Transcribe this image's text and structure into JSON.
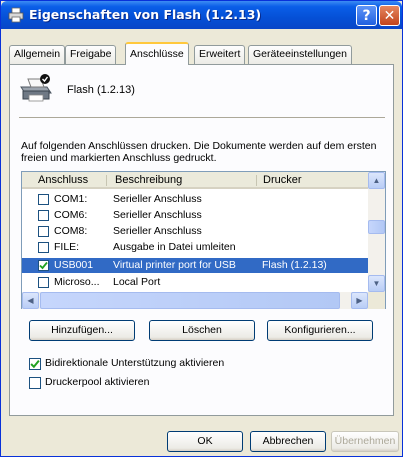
{
  "window": {
    "title": "Eigenschaften von Flash (1.2.13)",
    "help_label": "?",
    "close_label": "✕"
  },
  "tabs": [
    {
      "label": "Allgemein",
      "active": false
    },
    {
      "label": "Freigabe",
      "active": false
    },
    {
      "label": "Anschlüsse",
      "active": true
    },
    {
      "label": "Erweitert",
      "active": false
    },
    {
      "label": "Geräteeinstellungen",
      "active": false
    }
  ],
  "printer": {
    "name": "Flash (1.2.13)",
    "icon": "printer-icon"
  },
  "description": "Auf folgenden Anschlüssen drucken. Die Dokumente werden auf dem ersten freien und markierten Anschluss gedruckt.",
  "ports": {
    "headers": [
      "Anschluss",
      "Beschreibung",
      "Drucker"
    ],
    "rows": [
      {
        "checked": false,
        "port": "COM1:",
        "desc": "Serieller Anschluss",
        "printer": "",
        "selected": false
      },
      {
        "checked": false,
        "port": "COM6:",
        "desc": "Serieller Anschluss",
        "printer": "",
        "selected": false
      },
      {
        "checked": false,
        "port": "COM8:",
        "desc": "Serieller Anschluss",
        "printer": "",
        "selected": false
      },
      {
        "checked": false,
        "port": "FILE:",
        "desc": "Ausgabe in Datei umleiten",
        "printer": "",
        "selected": false
      },
      {
        "checked": true,
        "port": "USB001",
        "desc": "Virtual printer port for USB",
        "printer": "Flash (1.2.13)",
        "selected": true
      },
      {
        "checked": false,
        "port": "Microso...",
        "desc": "Local Port",
        "printer": "",
        "selected": false
      }
    ]
  },
  "port_buttons": {
    "add": "Hinzufügen...",
    "delete": "Löschen",
    "configure": "Konfigurieren..."
  },
  "options": {
    "bidi_label": "Bidirektionale Unterstützung aktivieren",
    "bidi_checked": true,
    "pool_label": "Druckerpool aktivieren",
    "pool_checked": false
  },
  "dialog_buttons": {
    "ok": "OK",
    "cancel": "Abbrechen",
    "apply": "Übernehmen"
  },
  "colors": {
    "titlebar": "#0550d6",
    "selection": "#316ac5",
    "active_tab_accent": "#ffc83c"
  }
}
